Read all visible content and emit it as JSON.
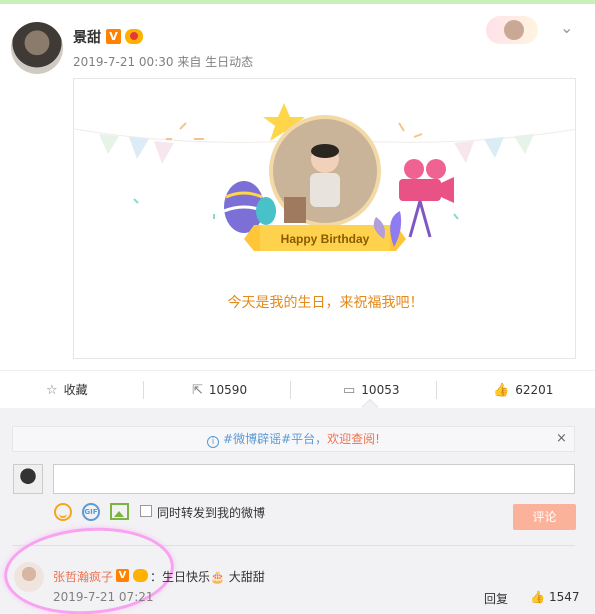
{
  "post": {
    "author": "景甜",
    "verified_badge": "V",
    "time": "2019-7-21 00:30",
    "source": "来自 生日动态",
    "more_icon": "chevron-down-icon"
  },
  "card": {
    "banner_text": "Happy Birthday",
    "message": "今天是我的生日，来祝福我吧！"
  },
  "actions": {
    "favorite": "收藏",
    "repost_count": "10590",
    "comment_count": "10053",
    "like_count": "62201"
  },
  "comment_box": {
    "notice_tag": "#微博辟谣#平台，",
    "notice_link": "欢迎查阅!",
    "info_icon": "i",
    "close_icon": "×",
    "gif_label": "GIF",
    "repost_option": "同时转发到我的微博",
    "submit": "评论"
  },
  "comment": {
    "name": "张哲瀚疯子",
    "verified_badge": "V",
    "text": "：生日快乐🎂 大甜甜",
    "time": "2019-7-21 07:21",
    "reply": "回复",
    "likes": "1547"
  },
  "colors": {
    "accent": "#eb7350",
    "brand_orange": "#ff8200",
    "highlight_pink": "#f7a3f0",
    "message_orange": "#e38a1c"
  }
}
